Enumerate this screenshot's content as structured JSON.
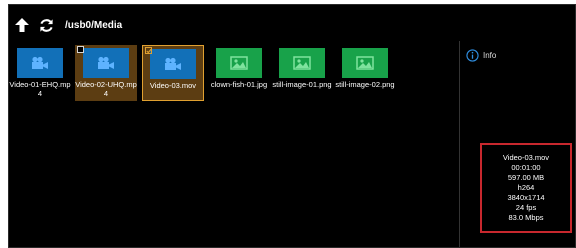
{
  "toolbar": {
    "path": "/usb0/Media"
  },
  "files": [
    {
      "name": "Video-01-EHQ.mp4",
      "kind": "video",
      "checkbox": false,
      "selected": false
    },
    {
      "name": "Video-02-UHQ.mp4",
      "kind": "video",
      "checkbox": true,
      "selected": false
    },
    {
      "name": "Video-03.mov",
      "kind": "video",
      "checkbox": true,
      "selected": true
    },
    {
      "name": "clown-fish-01.jpg",
      "kind": "image",
      "checkbox": false,
      "selected": false
    },
    {
      "name": "still-image-01.png",
      "kind": "image",
      "checkbox": false,
      "selected": false
    },
    {
      "name": "still-image-02.png",
      "kind": "image",
      "checkbox": false,
      "selected": false
    }
  ],
  "info": {
    "title": "Info",
    "details": [
      "Video-03.mov",
      "00:01:00",
      "597.00 MB",
      "h264",
      "3840x1714",
      "24 fps",
      "83.0 Mbps"
    ]
  },
  "colors": {
    "video_thumb": "#1270b8",
    "image_thumb": "#18a24a",
    "selection": "#e0a030",
    "highlight_box": "#c8282e"
  }
}
